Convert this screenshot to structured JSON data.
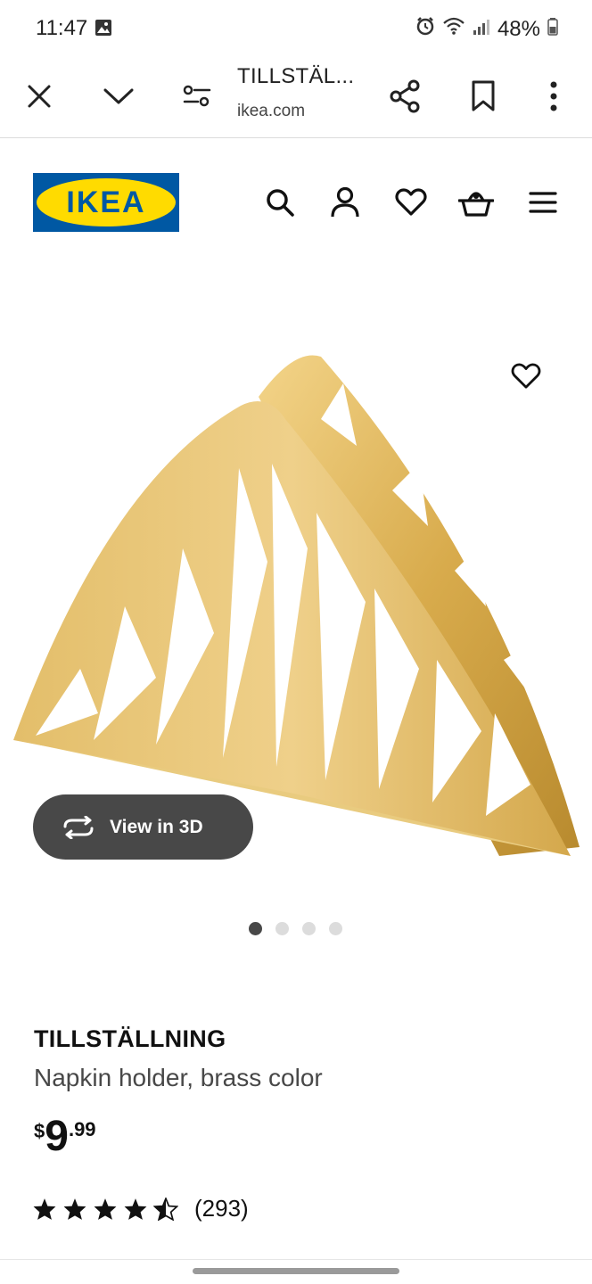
{
  "status_bar": {
    "time": "11:47",
    "battery": "48%"
  },
  "browser": {
    "tab_title": "TILLSTÄL...",
    "url": "ikea.com"
  },
  "header": {
    "logo_text": "IKEA"
  },
  "product": {
    "name": "TILLSTÄLLNING",
    "description": "Napkin holder, brass color",
    "price_currency": "$",
    "price_integer": "9",
    "price_decimal": ".99",
    "rating_stars": 4.5,
    "rating_count": "(293)",
    "view_3d_label": "View in 3D",
    "image_count": 4,
    "active_image": 1
  },
  "colors": {
    "ikea_blue": "#0058a3",
    "ikea_yellow": "#ffdb00",
    "brass": "#d9b45a",
    "dark_button": "#484848"
  },
  "icons": [
    "close-icon",
    "chevron-down-icon",
    "page-settings-icon",
    "share-icon",
    "bookmark-icon",
    "more-icon",
    "search-icon",
    "account-icon",
    "heart-icon",
    "basket-icon",
    "menu-icon",
    "rotate-3d-icon",
    "star-icon"
  ]
}
